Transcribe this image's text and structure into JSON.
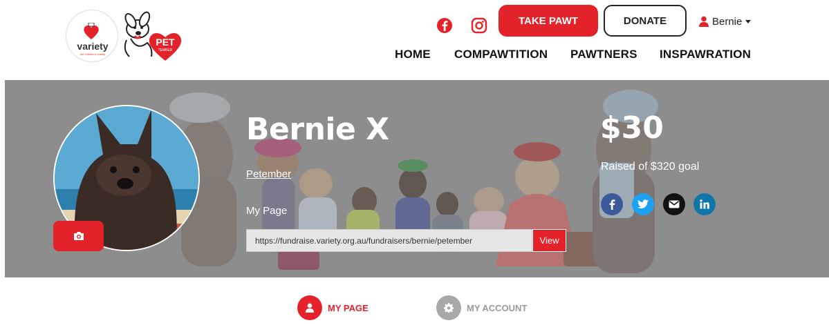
{
  "header": {
    "logo_variety_text": "variety",
    "logo_variety_sub": "the children's charity",
    "logo_pet_text": "PET",
    "logo_pet_sub": "TEMBER",
    "take_pawt_label": "TAKE PAWT",
    "donate_label": "DONATE",
    "user_name": "Bernie",
    "nav": [
      "HOME",
      "COMPAWTITION",
      "PAWTNERS",
      "INSPAWRATION"
    ]
  },
  "profile": {
    "name": "Bernie X",
    "campaign_link": "Petember",
    "my_page_label": "My Page",
    "page_url": "https://fundraise.variety.org.au/fundraisers/bernie/petember",
    "view_label": "View",
    "raised": "$30",
    "goal_text": "Raised of $320 goal"
  },
  "tabs": {
    "my_page": "MY PAGE",
    "my_account": "MY ACCOUNT"
  },
  "colors": {
    "accent": "#e4222a",
    "banner_gray": "#8d8d8d",
    "facebook": "#3b5998",
    "twitter": "#1da1f2",
    "linkedin": "#0e76a8"
  }
}
